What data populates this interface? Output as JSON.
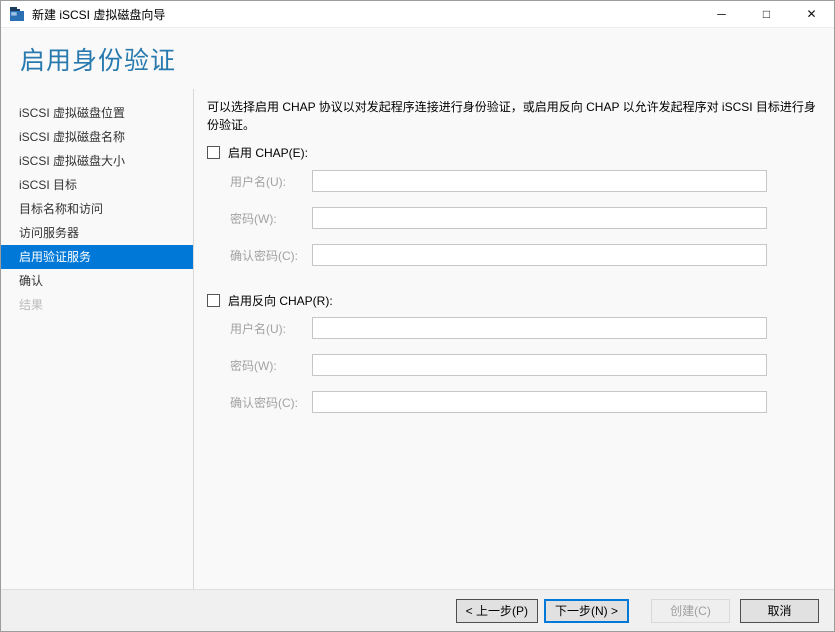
{
  "window": {
    "title": "新建 iSCSI 虚拟磁盘向导",
    "controls": {
      "minimize": "─",
      "maximize": "□",
      "close": "✕"
    }
  },
  "page": {
    "title": "启用身份验证"
  },
  "colors": {
    "accent": "#0078d7",
    "page_title": "#2779ae",
    "selected_nav_bg": "#0078d7"
  },
  "sidebar": {
    "items": [
      {
        "label": "iSCSI 虚拟磁盘位置",
        "state": "normal"
      },
      {
        "label": "iSCSI 虚拟磁盘名称",
        "state": "normal"
      },
      {
        "label": "iSCSI 虚拟磁盘大小",
        "state": "normal"
      },
      {
        "label": "iSCSI 目标",
        "state": "normal"
      },
      {
        "label": "目标名称和访问",
        "state": "normal"
      },
      {
        "label": "访问服务器",
        "state": "normal"
      },
      {
        "label": "启用验证服务",
        "state": "selected"
      },
      {
        "label": "确认",
        "state": "normal"
      },
      {
        "label": "结果",
        "state": "disabled"
      }
    ]
  },
  "content": {
    "description": "可以选择启用 CHAP 协议以对发起程序连接进行身份验证，或启用反向 CHAP 以允许发起程序对 iSCSI 目标进行身份验证。",
    "chap": {
      "checkbox_label": "启用 CHAP(E):",
      "checked": false,
      "fields": [
        {
          "label": "用户名(U):",
          "value": ""
        },
        {
          "label": "密码(W):",
          "value": ""
        },
        {
          "label": "确认密码(C):",
          "value": ""
        }
      ]
    },
    "reverse_chap": {
      "checkbox_label": "启用反向 CHAP(R):",
      "checked": false,
      "fields": [
        {
          "label": "用户名(U):",
          "value": ""
        },
        {
          "label": "密码(W):",
          "value": ""
        },
        {
          "label": "确认密码(C):",
          "value": ""
        }
      ]
    }
  },
  "footer": {
    "buttons": [
      {
        "label": "< 上一步(P)",
        "state": "normal"
      },
      {
        "label": "下一步(N) >",
        "state": "focused"
      },
      {
        "label": "创建(C)",
        "state": "disabled"
      },
      {
        "label": "取消",
        "state": "normal"
      }
    ]
  }
}
